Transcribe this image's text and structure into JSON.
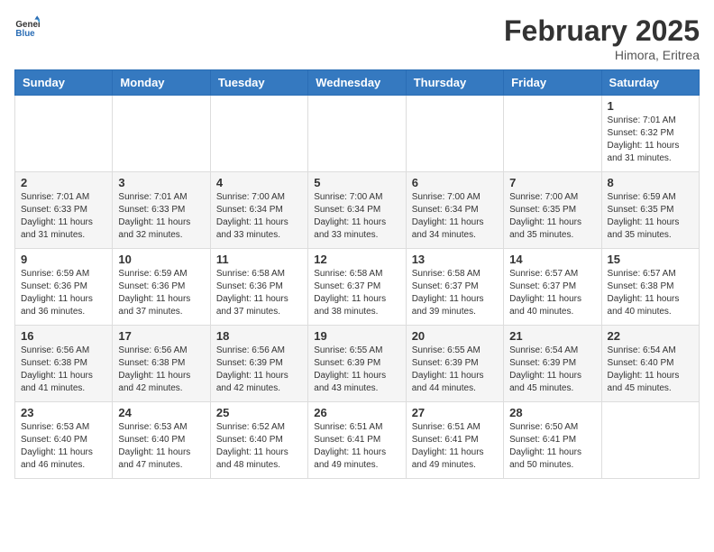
{
  "header": {
    "logo_general": "General",
    "logo_blue": "Blue",
    "month": "February 2025",
    "location": "Himora, Eritrea"
  },
  "days_of_week": [
    "Sunday",
    "Monday",
    "Tuesday",
    "Wednesday",
    "Thursday",
    "Friday",
    "Saturday"
  ],
  "weeks": [
    [
      {
        "day": "",
        "info": ""
      },
      {
        "day": "",
        "info": ""
      },
      {
        "day": "",
        "info": ""
      },
      {
        "day": "",
        "info": ""
      },
      {
        "day": "",
        "info": ""
      },
      {
        "day": "",
        "info": ""
      },
      {
        "day": "1",
        "info": "Sunrise: 7:01 AM\nSunset: 6:32 PM\nDaylight: 11 hours\nand 31 minutes."
      }
    ],
    [
      {
        "day": "2",
        "info": "Sunrise: 7:01 AM\nSunset: 6:33 PM\nDaylight: 11 hours\nand 31 minutes."
      },
      {
        "day": "3",
        "info": "Sunrise: 7:01 AM\nSunset: 6:33 PM\nDaylight: 11 hours\nand 32 minutes."
      },
      {
        "day": "4",
        "info": "Sunrise: 7:00 AM\nSunset: 6:34 PM\nDaylight: 11 hours\nand 33 minutes."
      },
      {
        "day": "5",
        "info": "Sunrise: 7:00 AM\nSunset: 6:34 PM\nDaylight: 11 hours\nand 33 minutes."
      },
      {
        "day": "6",
        "info": "Sunrise: 7:00 AM\nSunset: 6:34 PM\nDaylight: 11 hours\nand 34 minutes."
      },
      {
        "day": "7",
        "info": "Sunrise: 7:00 AM\nSunset: 6:35 PM\nDaylight: 11 hours\nand 35 minutes."
      },
      {
        "day": "8",
        "info": "Sunrise: 6:59 AM\nSunset: 6:35 PM\nDaylight: 11 hours\nand 35 minutes."
      }
    ],
    [
      {
        "day": "9",
        "info": "Sunrise: 6:59 AM\nSunset: 6:36 PM\nDaylight: 11 hours\nand 36 minutes."
      },
      {
        "day": "10",
        "info": "Sunrise: 6:59 AM\nSunset: 6:36 PM\nDaylight: 11 hours\nand 37 minutes."
      },
      {
        "day": "11",
        "info": "Sunrise: 6:58 AM\nSunset: 6:36 PM\nDaylight: 11 hours\nand 37 minutes."
      },
      {
        "day": "12",
        "info": "Sunrise: 6:58 AM\nSunset: 6:37 PM\nDaylight: 11 hours\nand 38 minutes."
      },
      {
        "day": "13",
        "info": "Sunrise: 6:58 AM\nSunset: 6:37 PM\nDaylight: 11 hours\nand 39 minutes."
      },
      {
        "day": "14",
        "info": "Sunrise: 6:57 AM\nSunset: 6:37 PM\nDaylight: 11 hours\nand 40 minutes."
      },
      {
        "day": "15",
        "info": "Sunrise: 6:57 AM\nSunset: 6:38 PM\nDaylight: 11 hours\nand 40 minutes."
      }
    ],
    [
      {
        "day": "16",
        "info": "Sunrise: 6:56 AM\nSunset: 6:38 PM\nDaylight: 11 hours\nand 41 minutes."
      },
      {
        "day": "17",
        "info": "Sunrise: 6:56 AM\nSunset: 6:38 PM\nDaylight: 11 hours\nand 42 minutes."
      },
      {
        "day": "18",
        "info": "Sunrise: 6:56 AM\nSunset: 6:39 PM\nDaylight: 11 hours\nand 42 minutes."
      },
      {
        "day": "19",
        "info": "Sunrise: 6:55 AM\nSunset: 6:39 PM\nDaylight: 11 hours\nand 43 minutes."
      },
      {
        "day": "20",
        "info": "Sunrise: 6:55 AM\nSunset: 6:39 PM\nDaylight: 11 hours\nand 44 minutes."
      },
      {
        "day": "21",
        "info": "Sunrise: 6:54 AM\nSunset: 6:39 PM\nDaylight: 11 hours\nand 45 minutes."
      },
      {
        "day": "22",
        "info": "Sunrise: 6:54 AM\nSunset: 6:40 PM\nDaylight: 11 hours\nand 45 minutes."
      }
    ],
    [
      {
        "day": "23",
        "info": "Sunrise: 6:53 AM\nSunset: 6:40 PM\nDaylight: 11 hours\nand 46 minutes."
      },
      {
        "day": "24",
        "info": "Sunrise: 6:53 AM\nSunset: 6:40 PM\nDaylight: 11 hours\nand 47 minutes."
      },
      {
        "day": "25",
        "info": "Sunrise: 6:52 AM\nSunset: 6:40 PM\nDaylight: 11 hours\nand 48 minutes."
      },
      {
        "day": "26",
        "info": "Sunrise: 6:51 AM\nSunset: 6:41 PM\nDaylight: 11 hours\nand 49 minutes."
      },
      {
        "day": "27",
        "info": "Sunrise: 6:51 AM\nSunset: 6:41 PM\nDaylight: 11 hours\nand 49 minutes."
      },
      {
        "day": "28",
        "info": "Sunrise: 6:50 AM\nSunset: 6:41 PM\nDaylight: 11 hours\nand 50 minutes."
      },
      {
        "day": "",
        "info": ""
      }
    ]
  ]
}
